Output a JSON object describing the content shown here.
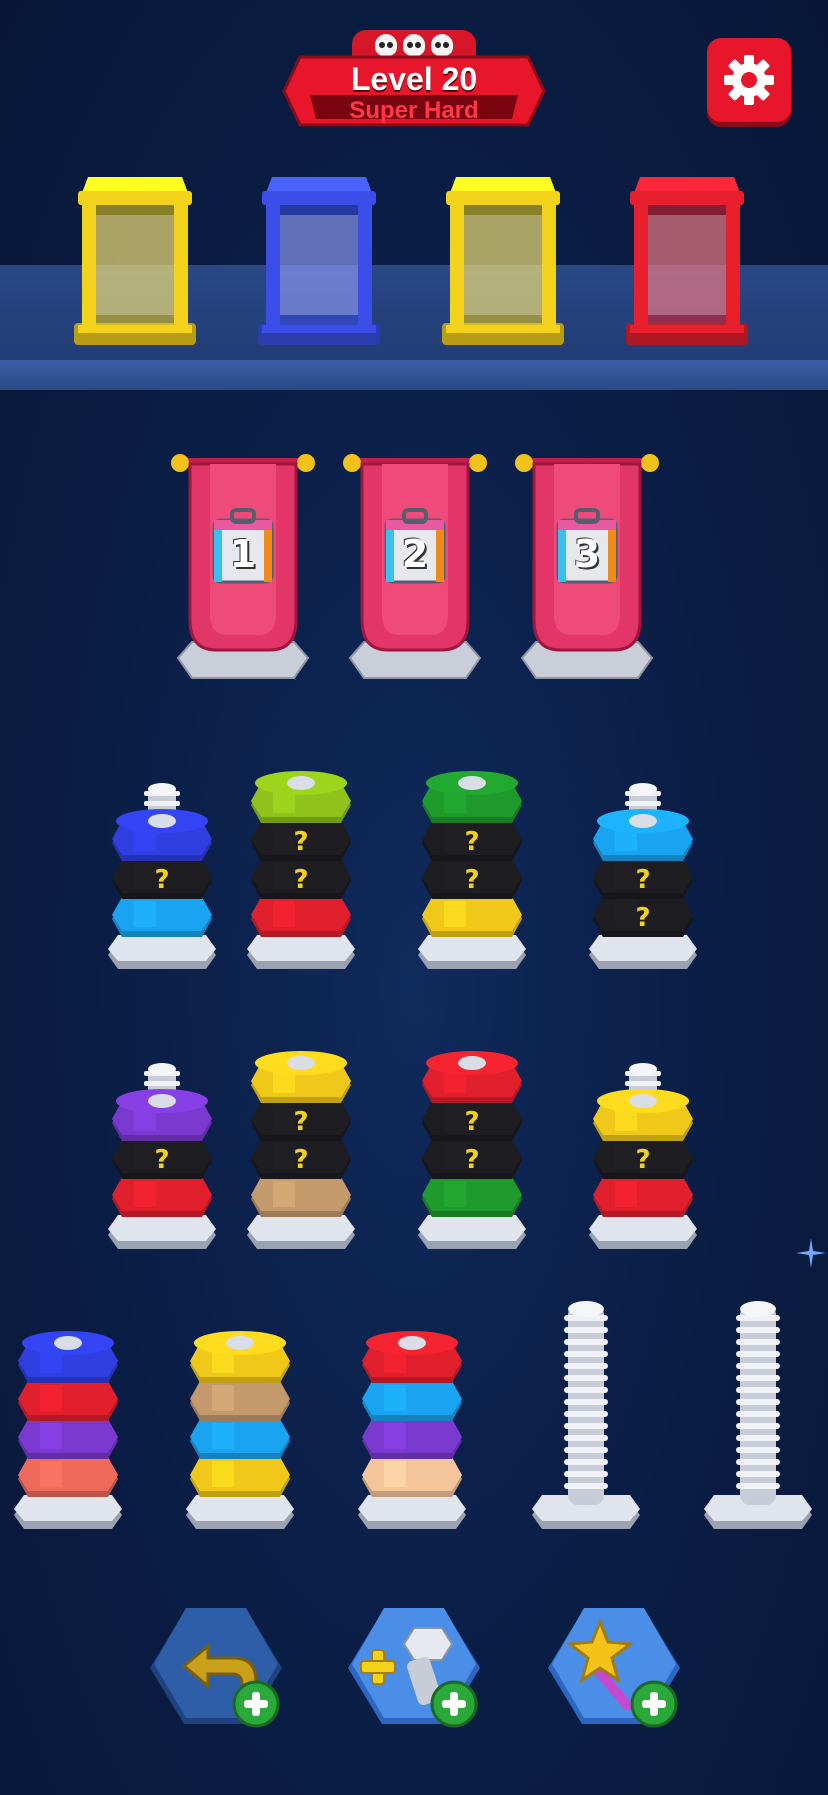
{
  "header": {
    "level_label": "Level 20",
    "difficulty_label": "Super Hard",
    "difficulty_icons": [
      "skull-icon",
      "skull-icon",
      "skull-icon"
    ],
    "settings_icon": "gear-icon"
  },
  "collection_boxes": [
    {
      "color": "#f2d21a"
    },
    {
      "color": "#3b4fe8"
    },
    {
      "color": "#f2d21a"
    },
    {
      "color": "#e8202e"
    }
  ],
  "locked_slots": [
    {
      "number": "1"
    },
    {
      "number": "2"
    },
    {
      "number": "3"
    }
  ],
  "bolts": {
    "row1": [
      {
        "nuts": [
          "blue",
          "black-?",
          "skyblue"
        ]
      },
      {
        "nuts": [
          "lime",
          "black-?",
          "black-?",
          "red"
        ]
      },
      {
        "nuts": [
          "green",
          "black-?",
          "black-?",
          "yellow"
        ]
      },
      {
        "nuts": [
          "skyblue",
          "black-?",
          "black-?"
        ]
      }
    ],
    "row2": [
      {
        "nuts": [
          "purple",
          "black-?",
          "red"
        ]
      },
      {
        "nuts": [
          "yellow",
          "black-?",
          "black-?",
          "tan"
        ]
      },
      {
        "nuts": [
          "red",
          "black-?",
          "black-?",
          "green"
        ]
      },
      {
        "nuts": [
          "yellow",
          "black-?",
          "red"
        ]
      }
    ],
    "row3": [
      {
        "nuts": [
          "blue",
          "red",
          "purple",
          "salmon"
        ]
      },
      {
        "nuts": [
          "yellow",
          "tan",
          "skyblue",
          "yellow"
        ]
      },
      {
        "nuts": [
          "red",
          "skyblue",
          "purple",
          "peach"
        ]
      },
      {
        "nuts": []
      },
      {
        "nuts": []
      }
    ],
    "hidden_nut_mark": "?"
  },
  "tools": [
    {
      "name": "undo",
      "icon": "undo-arrow-icon"
    },
    {
      "name": "add-bolt",
      "icon": "bolt-plus-icon"
    },
    {
      "name": "magic-wand",
      "icon": "star-wand-icon"
    }
  ],
  "colors": {
    "blue": "#2f3fe0",
    "skyblue": "#1aa3f0",
    "lime": "#8fc21a",
    "green": "#1f9a2c",
    "red": "#e0202c",
    "yellow": "#f0c81a",
    "purple": "#7a3ad0",
    "tan": "#c49a6c",
    "salmon": "#ef6a5a",
    "peach": "#f4c49a",
    "black": "#1d1d22"
  }
}
